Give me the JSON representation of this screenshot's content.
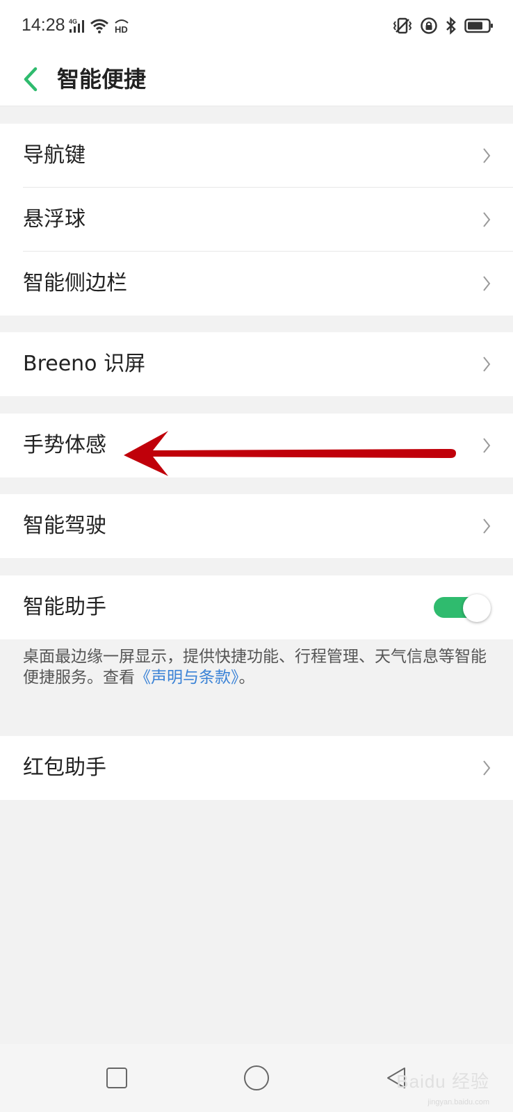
{
  "status_bar": {
    "time": "14:28",
    "left_icons": [
      "signal-4g-icon",
      "wifi-icon",
      "hd-icon"
    ],
    "right_icons": [
      "vibrate-icon",
      "rotation-lock-icon",
      "bluetooth-icon",
      "battery-icon"
    ]
  },
  "header": {
    "title": "智能便捷",
    "back_icon": "chevron-left-icon"
  },
  "groups": {
    "navigation": {
      "items": [
        {
          "label": "导航键"
        },
        {
          "label": "悬浮球"
        },
        {
          "label": "智能侧边栏"
        }
      ]
    },
    "breeno": {
      "label": "Breeno 识屏"
    },
    "gesture": {
      "label": "手势体感"
    },
    "driving": {
      "label": "智能驾驶"
    },
    "assistant": {
      "label": "智能助手",
      "toggle_on": true,
      "description_text": "桌面最边缘一屏显示，提供快捷功能、行程管理、天气信息等智能便捷服务。查看",
      "description_link": "《声明与条款》",
      "description_end": "。"
    },
    "red_packet": {
      "label": "红包助手"
    }
  },
  "colors": {
    "accent": "#2fbb6e",
    "link": "#3a82d6",
    "annotation_arrow": "#c0000a",
    "background": "#f2f2f2"
  },
  "nav_bar": {
    "icons": [
      "recent-apps-icon",
      "home-icon",
      "back-icon"
    ]
  },
  "watermark": {
    "text": "Baidu 经验",
    "sub": "jingyan.baidu.com"
  }
}
